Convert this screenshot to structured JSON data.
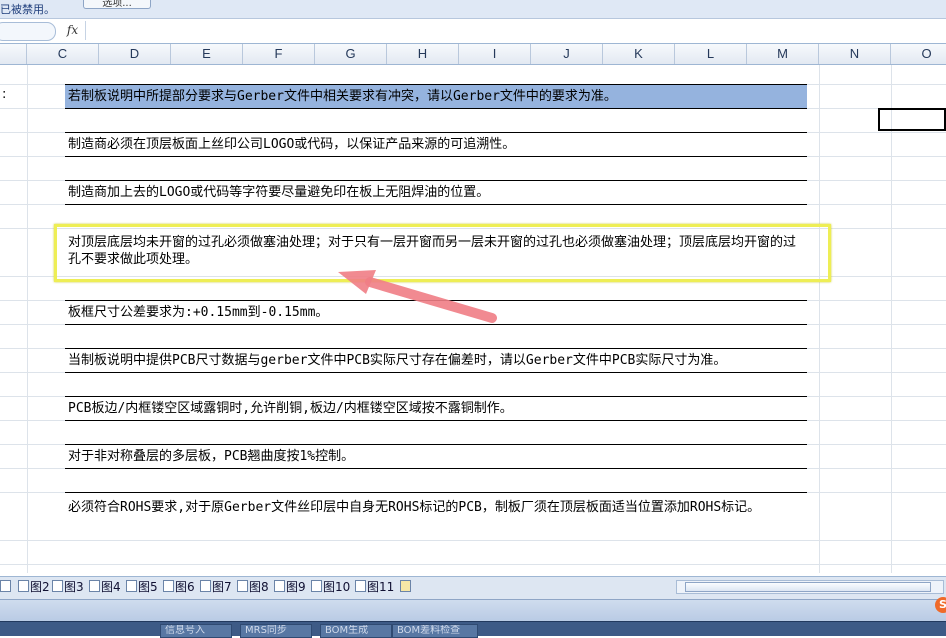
{
  "topbar": {
    "message": "已被禁用。",
    "options_button": "选项..."
  },
  "formula_bar": {
    "fx_label": "fx",
    "value": ""
  },
  "column_headers": [
    "C",
    "D",
    "E",
    "F",
    "G",
    "H",
    "I",
    "J",
    "K",
    "L",
    "M",
    "N",
    "O"
  ],
  "row_label": ":",
  "cells": [
    {
      "text": "若制板说明中所提部分要求与Gerber文件中相关要求有冲突，请以Gerber文件中的要求为准。",
      "selected": true
    },
    {
      "text": "制造商必须在顶层板面上丝印公司LOGO或代码，以保证产品来源的可追溯性。"
    },
    {
      "text": "制造商加上去的LOGO或代码等字符要尽量避免印在板上无阻焊油的位置。"
    },
    {
      "text": "对顶层底层均未开窗的过孔必须做塞油处理；对于只有一层开窗而另一层未开窗的过孔也必须做塞油处理；顶层底层均开窗的过孔不要求做此项处理。",
      "highlighted": true
    },
    {
      "text": "板框尺寸公差要求为:+0.15mm到-0.15mm。"
    },
    {
      "text": "当制板说明中提供PCB尺寸数据与gerber文件中PCB实际尺寸存在偏差时，请以Gerber文件中PCB实际尺寸为准。"
    },
    {
      "text": "PCB板边/内框镂空区域露铜时,允许削铜,板边/内框镂空区域按不露铜制作。"
    },
    {
      "text": "对于非对称叠层的多层板，PCB翘曲度按1%控制。"
    },
    {
      "text": "必须符合ROHS要求,对于原Gerber文件丝印层中自身无ROHS标记的PCB，制板厂须在顶层板面适当位置添加ROHS标记。"
    }
  ],
  "sheet_tabs": [
    "图2",
    "图3",
    "图4",
    "图5",
    "图6",
    "图7",
    "图8",
    "图9",
    "图10",
    "图11"
  ],
  "taskbar": [
    "信息号入",
    "MRS同步",
    "BOM生成",
    "BOM差料检查"
  ],
  "colors": {
    "selection": "#95b3de",
    "highlight_box": "#eeee55",
    "arrow": "#f07d85"
  }
}
